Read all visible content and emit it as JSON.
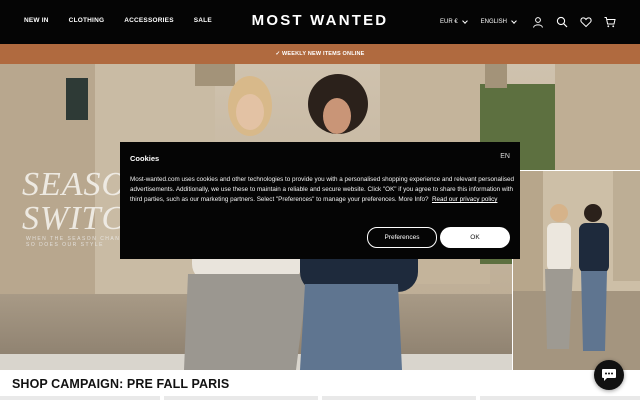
{
  "header": {
    "nav": [
      "NEW IN",
      "CLOTHING",
      "ACCESSORIES",
      "SALE"
    ],
    "logo": "MOST WANTED",
    "currency": "EUR €",
    "language": "ENGLISH",
    "icons": [
      "account-icon",
      "search-icon",
      "wishlist-heart-icon",
      "cart-icon"
    ]
  },
  "promo": {
    "text": "✓ WEEKLY NEW ITEMS ONLINE"
  },
  "hero": {
    "title_line1": "SEASO",
    "title_line2": "SWITC",
    "subtitle_line1": "WHEN THE SEASON CHAN",
    "subtitle_line2": "SO DOES OUR STYLE"
  },
  "shop": {
    "title": "SHOP CAMPAIGN: PRE FALL PARIS"
  },
  "cookie": {
    "title": "Cookies",
    "lang": "EN",
    "body": "Most-wanted.com uses cookies and other technologies to provide you with a personalised shopping experience and relevant personalised advertisements. Additionally, we use these to maintain a reliable and secure website. Click \"OK\" if you agree to share this information with third parties, such as our marketing partners. Select \"Preferences\" to manage your preferences. More Info?",
    "link": "Read our privacy policy",
    "preferences_label": "Preferences",
    "ok_label": "OK"
  },
  "chat": {
    "icon": "chat-bubble-icon"
  },
  "colors": {
    "header_bg": "#050505",
    "promo_bg": "#b06a3f",
    "modal_bg": "#050505"
  }
}
